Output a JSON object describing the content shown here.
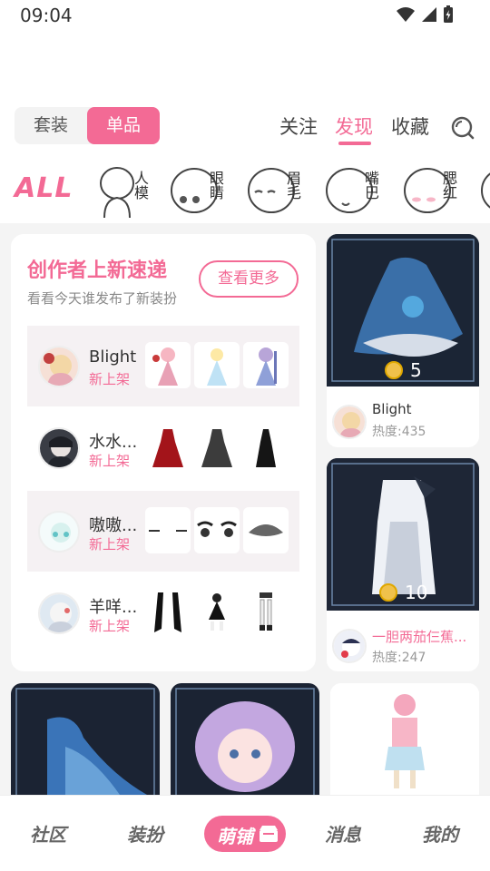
{
  "status_bar": {
    "time": "09:04"
  },
  "header": {
    "toggle": {
      "set_label": "套装",
      "single_label": "单品"
    },
    "tabs": [
      {
        "label": "关注",
        "active": false
      },
      {
        "label": "发现",
        "active": true
      },
      {
        "label": "收藏",
        "active": false
      }
    ],
    "search_icon": "search-icon"
  },
  "categories": {
    "all_label": "ALL",
    "items": [
      {
        "label": "人模"
      },
      {
        "label": "眼睛"
      },
      {
        "label": "眉毛"
      },
      {
        "label": "嘴巴"
      },
      {
        "label": "腮红"
      }
    ]
  },
  "creator_card": {
    "title": "创作者上新速递",
    "subtitle": "看看今天谁发布了新装扮",
    "more_button": "查看更多",
    "rows": [
      {
        "name": "Blight",
        "tag": "新上架"
      },
      {
        "name": "水水...",
        "tag": "新上架"
      },
      {
        "name": "嗷嗷...",
        "tag": "新上架"
      },
      {
        "name": "羊咩...",
        "tag": "新上架"
      }
    ]
  },
  "items": [
    {
      "price": "5",
      "author": "Blight",
      "heat": "热度:435"
    },
    {
      "price": "10",
      "author": "一胆两茄仨蕉...",
      "heat": "热度:247"
    }
  ],
  "bottom_nav": {
    "items": [
      {
        "label": "社区"
      },
      {
        "label": "装扮"
      },
      {
        "label": "萌铺",
        "active": true
      },
      {
        "label": "消息"
      },
      {
        "label": "我的"
      }
    ]
  },
  "colors": {
    "accent": "#f36a95",
    "background": "#f4f4f4"
  }
}
